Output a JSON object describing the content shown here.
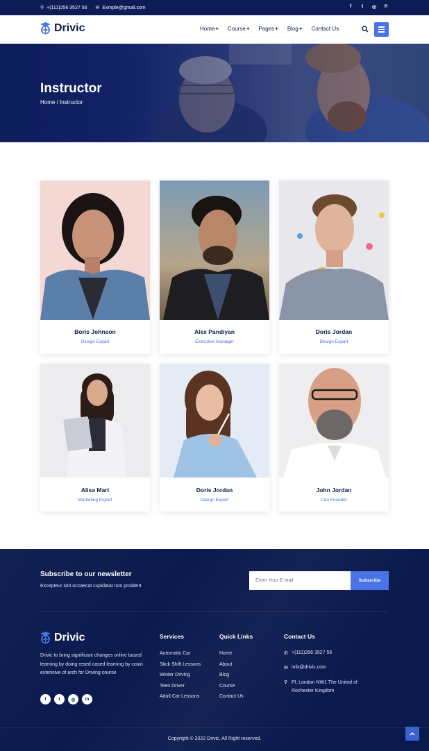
{
  "topbar": {
    "phone": "+(111)256 3527 56",
    "email": "Exmple@gmail.com",
    "social": [
      "f",
      "t",
      "ig",
      "p"
    ]
  },
  "brand": {
    "name": "Drivic"
  },
  "nav": {
    "items": [
      {
        "label": "Home",
        "has_sub": true
      },
      {
        "label": "Course",
        "has_sub": true
      },
      {
        "label": "Pages",
        "has_sub": true
      },
      {
        "label": "Blog",
        "has_sub": true
      },
      {
        "label": "Contact Us",
        "has_sub": false
      }
    ],
    "plus": "+"
  },
  "hero": {
    "title": "Instructor",
    "breadcrumb": "Home / Instructor"
  },
  "instructors": [
    {
      "name": "Boris Johnson",
      "role": "Design Expart"
    },
    {
      "name": "Alex Pandiyan",
      "role": "Executive Manager"
    },
    {
      "name": "Doris Jordan",
      "role": "Design Expart"
    },
    {
      "name": "Alisa Mart",
      "role": "Marketing Expart"
    },
    {
      "name": "Doris Jordan",
      "role": "Design Expart"
    },
    {
      "name": "John Jordan",
      "role": "Ceo Founder"
    }
  ],
  "newsletter": {
    "title": "Subscribe to our newsletter",
    "subtitle": "Excepteur sint occaecat cupidatat non proident",
    "placeholder": "Enter Your E-mail",
    "button": "Subscribe"
  },
  "footer": {
    "about": "Drivic to bring significant changes online based learning by doing resed cased learning by cosin extensive of arch for Driving course",
    "social": [
      "f",
      "t",
      "ig",
      "in"
    ],
    "services_title": "Services",
    "services": [
      "Automatic Car",
      "Stick Shift Lessons",
      "Winter Driving",
      "Teen Driver",
      "Adult Car Lessons"
    ],
    "links_title": "Quick Links",
    "links": [
      "Home",
      "About",
      "Blog",
      "Course",
      "Contact Us"
    ],
    "contact_title": "Contact Us",
    "contact_phone": "+(111)256 3527 56",
    "contact_email": "info@drivic.com",
    "contact_address_1": "Pl, London NW1 The United of",
    "contact_address_2": "Rochester Kingdom",
    "copyright": "Copyright © 2022 Drivic. All Right reserved."
  },
  "colors": {
    "navy": "#0d1b57",
    "accent": "#4a73e8",
    "footer": "#0b1a4d"
  }
}
